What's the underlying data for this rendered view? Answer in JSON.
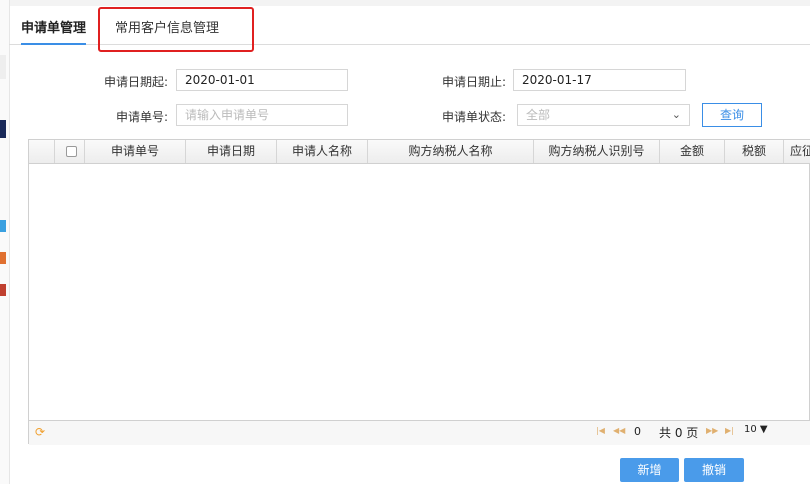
{
  "tabs": [
    {
      "label": "申请单管理"
    },
    {
      "label": "常用客户信息管理"
    }
  ],
  "filters": {
    "date_start_label": "申请日期起:",
    "date_start_value": "2020-01-01",
    "date_end_label": "申请日期止:",
    "date_end_value": "2020-01-17",
    "number_label": "申请单号:",
    "number_placeholder": "请输入申请单号",
    "status_label": "申请单状态:",
    "status_value": "全部",
    "query_button": "查询"
  },
  "table": {
    "columns": [
      "申请单号",
      "申请日期",
      "申请人名称",
      "购方纳税人名称",
      "购方纳税人识别号",
      "金额",
      "税额",
      "应征"
    ]
  },
  "pager": {
    "current_page": "0",
    "total_text": "共 0 页",
    "page_size": "10 ▼"
  },
  "actions": {
    "add_button": "新增",
    "revoke_button": "撤销"
  },
  "colors": {
    "accent": "#3a8ee6",
    "highlight": "#e02020",
    "button": "#4a9bea"
  }
}
